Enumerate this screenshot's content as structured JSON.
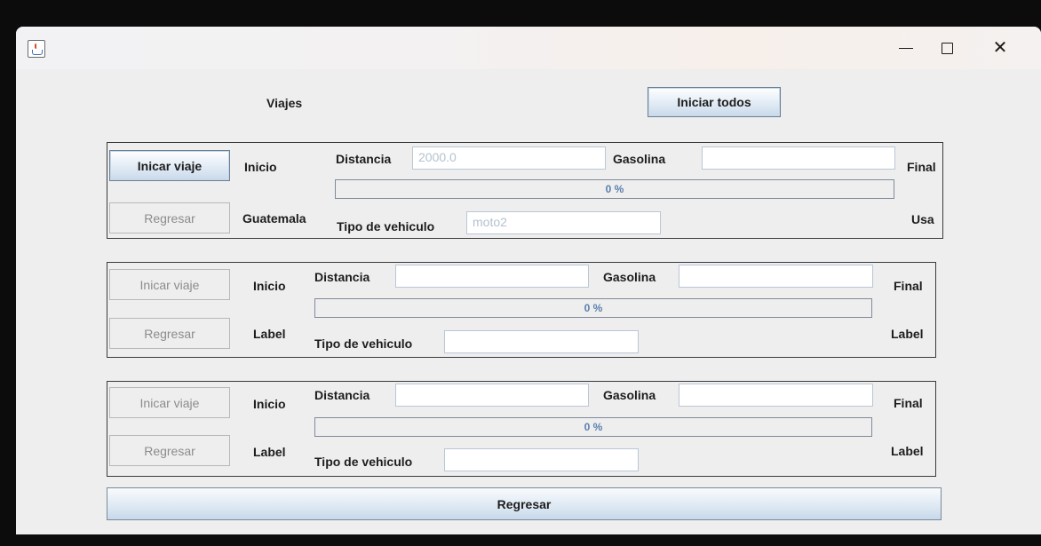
{
  "window": {
    "minimize_label": "—",
    "maximize_label": "",
    "close_label": "✕"
  },
  "header": {
    "title": "Viajes",
    "start_all_label": "Iniciar todos"
  },
  "trips": [
    {
      "start_button": "Inicar viaje",
      "back_button": "Regresar",
      "start_label": "Inicio",
      "origin": "Guatemala",
      "distance_label": "Distancia",
      "distance_value": "2000.0",
      "fuel_label": "Gasolina",
      "fuel_value": "",
      "progress_text": "0 %",
      "vehicle_label": "Tipo de vehiculo",
      "vehicle_value": "moto2",
      "end_label": "Final",
      "destination": "Usa"
    },
    {
      "start_button": "Inicar viaje",
      "back_button": "Regresar",
      "start_label": "Inicio",
      "origin": "Label",
      "distance_label": "Distancia",
      "distance_value": "",
      "fuel_label": "Gasolina",
      "fuel_value": "",
      "progress_text": "0 %",
      "vehicle_label": "Tipo de vehiculo",
      "vehicle_value": "",
      "end_label": "Final",
      "destination": "Label"
    },
    {
      "start_button": "Inicar viaje",
      "back_button": "Regresar",
      "start_label": "Inicio",
      "origin": "Label",
      "distance_label": "Distancia",
      "distance_value": "",
      "fuel_label": "Gasolina",
      "fuel_value": "",
      "progress_text": "0 %",
      "vehicle_label": "Tipo de vehiculo",
      "vehicle_value": "",
      "end_label": "Final",
      "destination": "Label"
    }
  ],
  "footer": {
    "back_label": "Regresar"
  },
  "colors": {
    "background": "#eeeeee",
    "progress_text": "#5b7fae",
    "disabled_text": "#9a9a9a"
  }
}
